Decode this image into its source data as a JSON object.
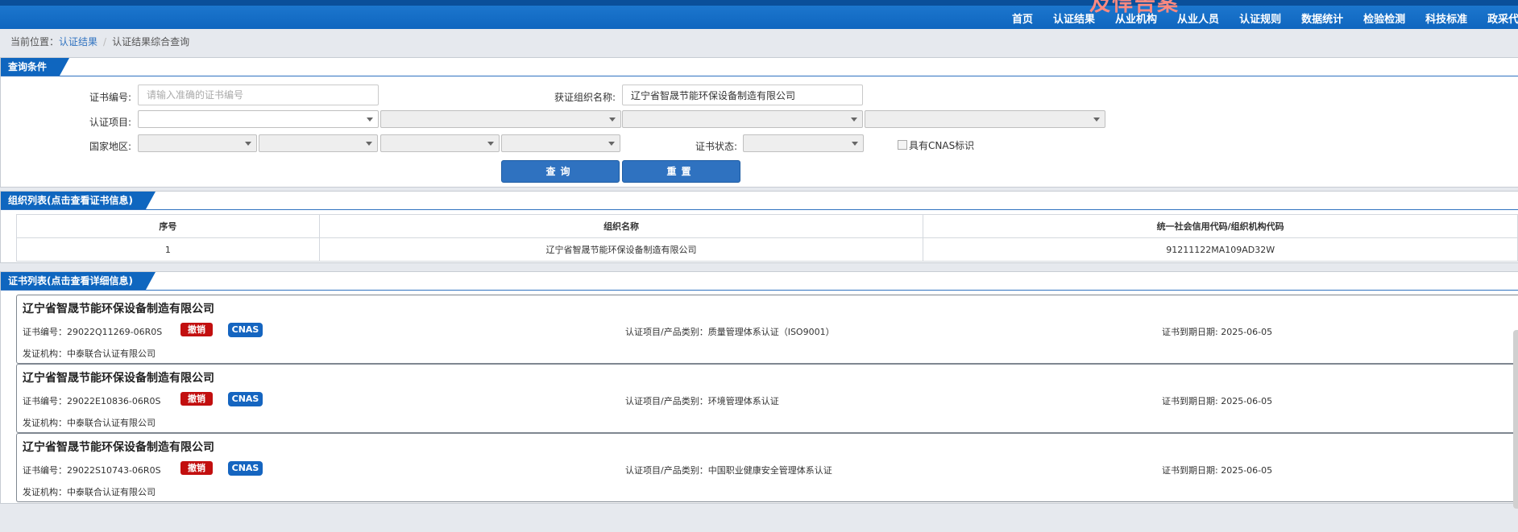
{
  "nav": {
    "brand": "及悍告案",
    "items": [
      "首页",
      "认证结果",
      "从业机构",
      "从业人员",
      "认证规则",
      "数据统计",
      "检验检测",
      "科技标准",
      "政采代"
    ]
  },
  "breadcrumb": {
    "prefix": "当前位置：",
    "link": "认证结果",
    "sep": "/",
    "current": "认证结果综合查询"
  },
  "query": {
    "title": "查询条件",
    "cert_no_label": "证书编号:",
    "cert_no_placeholder": "请输入准确的证书编号",
    "org_label": "获证组织名称:",
    "org_value": "辽宁省智晟节能环保设备制造有限公司",
    "project_label": "认证项目:",
    "region_label": "国家地区:",
    "status_label": "证书状态:",
    "cnas_label": "具有CNAS标识",
    "search_button": "查询",
    "reset_button": "重置"
  },
  "org_list": {
    "title": "组织列表(点击查看证书信息)",
    "headers": [
      "序号",
      "组织名称",
      "统一社会信用代码/组织机构代码"
    ],
    "rows": [
      [
        "1",
        "辽宁省智晟节能环保设备制造有限公司",
        "91211122MA109AD32W"
      ]
    ]
  },
  "cert_list": {
    "title": "证书列表(点击查看详细信息)",
    "revoked_badge": "撤销",
    "cnas_badge": "CNAS",
    "items": [
      {
        "org": "辽宁省智晟节能环保设备制造有限公司",
        "cert_no": "证书编号：29022Q11269-06R0S",
        "project": "认证项目/产品类别：质量管理体系认证（ISO9001）",
        "expiry": "证书到期日期: 2025-06-05",
        "issuer": "发证机构：中泰联合认证有限公司"
      },
      {
        "org": "辽宁省智晟节能环保设备制造有限公司",
        "cert_no": "证书编号：29022E10836-06R0S",
        "project": "认证项目/产品类别：环境管理体系认证",
        "expiry": "证书到期日期: 2025-06-05",
        "issuer": "发证机构：中泰联合认证有限公司"
      },
      {
        "org": "辽宁省智晟节能环保设备制造有限公司",
        "cert_no": "证书编号：29022S10743-06R0S",
        "project": "认证项目/产品类别：中国职业健康安全管理体系认证",
        "expiry": "证书到期日期: 2025-06-05",
        "issuer": "发证机构：中泰联合认证有限公司"
      }
    ]
  },
  "colors": {
    "brand_blue": "#0f66bf",
    "button_blue": "#2f72c0",
    "revoked_red": "#c20f0f",
    "cnas_blue": "#1565c0"
  }
}
